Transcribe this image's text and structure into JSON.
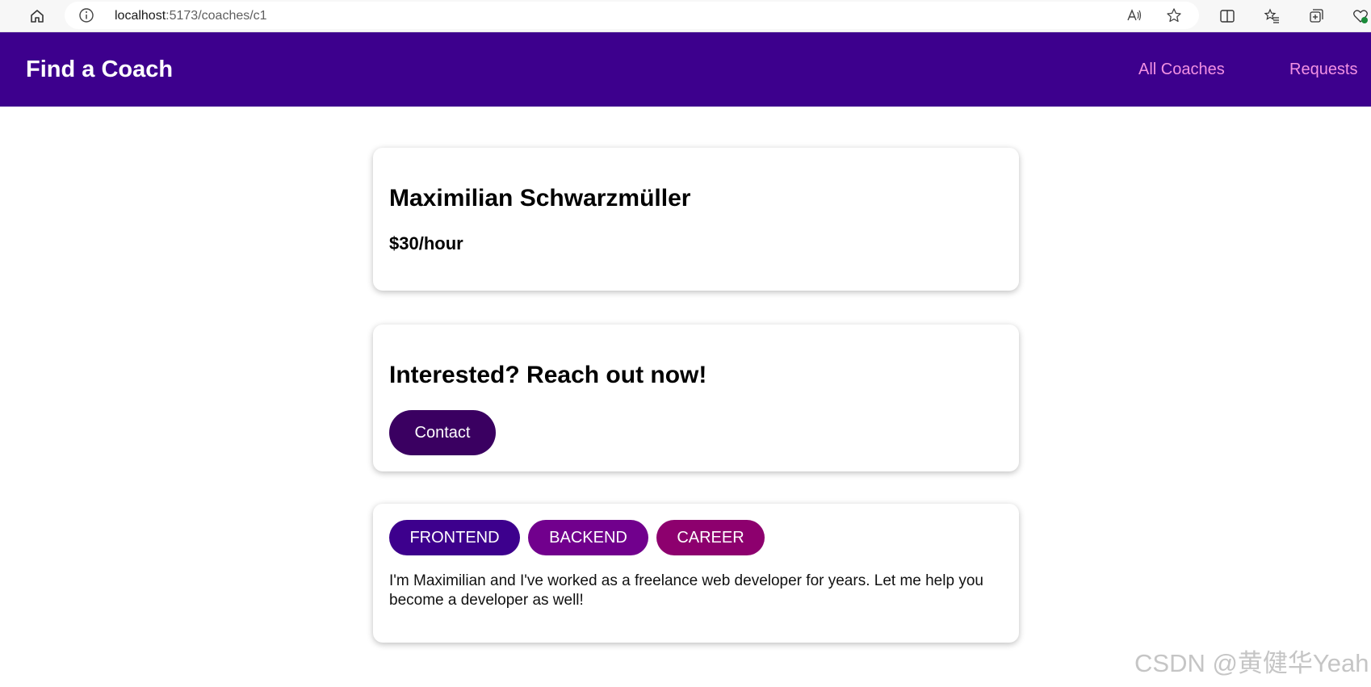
{
  "browser": {
    "url_host": "localhost",
    "url_path": ":5173/coaches/c1",
    "icons": [
      "home-icon",
      "info-icon",
      "read-aloud-icon",
      "favorite-star-icon",
      "split-screen-icon",
      "favorites-icon",
      "collections-icon",
      "browser-essentials-icon"
    ]
  },
  "header": {
    "brand": "Find a Coach",
    "nav": {
      "coaches": "All Coaches",
      "requests": "Requests"
    }
  },
  "coach": {
    "name": "Maximilian Schwarzmüller",
    "rate": "$30/hour",
    "areas": [
      "FRONTEND",
      "BACKEND",
      "CAREER"
    ],
    "description": "I'm Maximilian and I've worked as a freelance web developer for years. Let me help you become a developer as well!"
  },
  "contact": {
    "heading": "Interested? Reach out now!",
    "button": "Contact"
  },
  "watermark": "CSDN @黄健华Yeah",
  "colors": {
    "header_bg": "#3d008d",
    "nav_link": "#f391e3",
    "contact_button": "#3a0061",
    "badge_frontend": "#3d008d",
    "badge_backend": "#71008d",
    "badge_career": "#8d006e"
  }
}
